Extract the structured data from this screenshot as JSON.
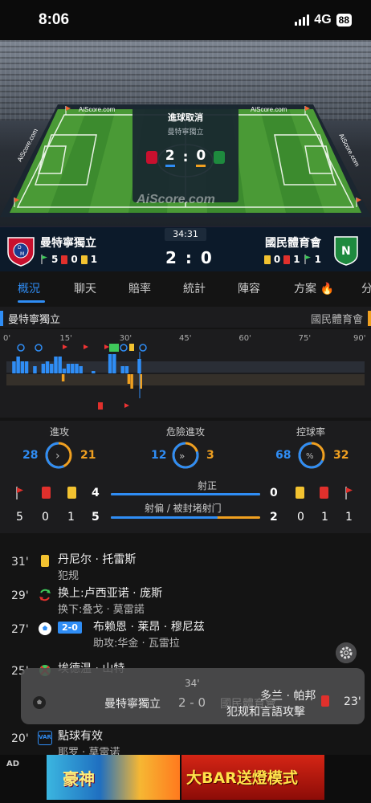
{
  "status_bar": {
    "time": "8:06",
    "network": "4G",
    "battery": "88"
  },
  "stadium": {
    "goal_card_title": "進球取消",
    "goal_card_team": "曼特寧獨立",
    "goal_card_score_home": "2",
    "goal_card_score_away": "0",
    "score_sep": ":",
    "watermark": "AiScore.com",
    "board_left": "AiScore.com",
    "board_right": "AiScore.com",
    "board_side_left": "AiScore.com",
    "board_side_right": "AiScore.com"
  },
  "match": {
    "home_name": "曼特寧獨立",
    "away_name": "國民體育會",
    "minute": "34:31",
    "score": "2 : 0",
    "home_stats": {
      "corners": "5",
      "red": "0",
      "yellow": "1"
    },
    "away_stats": {
      "yellow": "0",
      "red": "1",
      "corners": "1"
    },
    "home_crest_text": "D\nM",
    "away_crest_text": "N"
  },
  "tabs": [
    "概況",
    "聊天",
    "賠率",
    "統計",
    "陣容",
    "方案",
    "分"
  ],
  "timeline": {
    "home_label": "曼特寧獨立",
    "away_label": "國民體育會",
    "ticks": [
      "0'",
      "15'",
      "30'",
      "45'",
      "60'",
      "75'",
      "90'"
    ],
    "home_pressure": [
      0,
      5,
      7,
      5,
      5,
      0,
      3,
      0,
      4,
      5,
      4,
      7,
      7,
      2,
      4,
      4,
      4,
      3,
      0,
      0,
      1,
      0,
      0,
      0,
      8,
      8,
      0,
      3,
      3,
      0,
      0,
      6
    ],
    "away_pressure": [
      0,
      0,
      0,
      0,
      0,
      0,
      0,
      0,
      0,
      0,
      0,
      0,
      0,
      0,
      0,
      0,
      0,
      0,
      3,
      0,
      0,
      0,
      0,
      0,
      0,
      0,
      0,
      0,
      0,
      0,
      0,
      0,
      0,
      0,
      0,
      0,
      0,
      0,
      0,
      0,
      4,
      6,
      0,
      0,
      6,
      0,
      0,
      0
    ]
  },
  "stats": {
    "attack": {
      "label": "進攻",
      "home": "28",
      "away": "21"
    },
    "danger": {
      "label": "危險進攻",
      "home": "12",
      "away": "3"
    },
    "possession": {
      "label": "控球率",
      "home": "68",
      "away": "32",
      "symbol": "%"
    },
    "shots_on": {
      "label": "射正",
      "home": "4",
      "away": "0",
      "home_ratio": 1.0
    },
    "shots_off": {
      "label": "射偏 / 被封堵射门",
      "home": "5",
      "away": "2",
      "home_ratio": 0.714
    },
    "home_counts": {
      "corners": "5",
      "red": "0",
      "yellow": "1"
    },
    "away_counts": {
      "yellow": "0",
      "red": "1",
      "corners": "1"
    }
  },
  "events": [
    {
      "minute": "31'",
      "main": "丹尼尔 · 托雷斯",
      "sub": "犯规",
      "icon": "yellow-card-icon"
    },
    {
      "minute": "29'",
      "main": "换上:卢西亚诺 · 庞斯",
      "sub": "换下:叠戈 · 莫雷諾",
      "icon": "substitution-icon"
    },
    {
      "minute": "27'",
      "main": "布赖恩 · 莱昂 · 穆尼兹",
      "sub": "助攻:华金 · 瓦雷拉",
      "icon": "goal-icon",
      "score": "2-0"
    },
    {
      "minute": "25'",
      "main": "埃德温 · 山特",
      "sub": "",
      "icon": "missed-penalty-icon"
    },
    {
      "minute": "20'",
      "main": "點球有效",
      "sub": "耶罗 · 莫雷诺",
      "icon": "var-icon",
      "icon_text": "VAR"
    }
  ],
  "toast": {
    "minute": "34'",
    "home": "曼特寧獨立",
    "score": "2 - 0",
    "away": "國民體育會",
    "player": "多兰 · 帕邦",
    "reason": "犯规和言語攻擊",
    "event_minute": "23'"
  },
  "ad": {
    "label": "AD",
    "banner_left": "豪神",
    "banner_right": "大BAR送燈模式"
  },
  "colors": {
    "home": "#2f8df5",
    "away": "#f0a020",
    "red_card": "#e0302c",
    "yellow_card": "#f2c230"
  }
}
